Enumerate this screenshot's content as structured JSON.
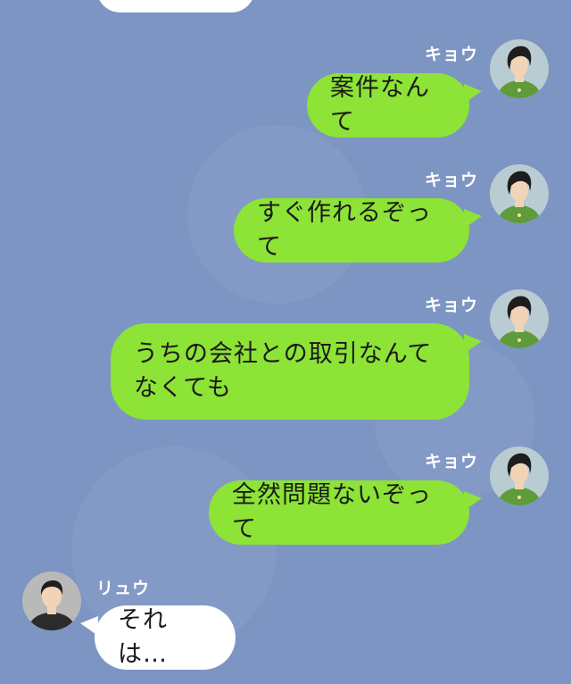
{
  "chat": {
    "messages": [
      {
        "sender": "",
        "text": ""
      },
      {
        "sender": "キョウ",
        "text": "案件なんて"
      },
      {
        "sender": "キョウ",
        "text": "すぐ作れるぞって"
      },
      {
        "sender": "キョウ",
        "text": "うちの会社との取引なんてなくても"
      },
      {
        "sender": "キョウ",
        "text": "全然問題ないぞって"
      },
      {
        "sender": "リュウ",
        "text": "それは…"
      }
    ]
  },
  "colors": {
    "background": "#7d95c3",
    "outgoing_bubble": "#8de336",
    "incoming_bubble": "#ffffff",
    "name_text": "#ffffff"
  },
  "icons": {
    "kyou_avatar": "woman-avatar-icon",
    "ryuu_avatar": "man-avatar-icon"
  }
}
